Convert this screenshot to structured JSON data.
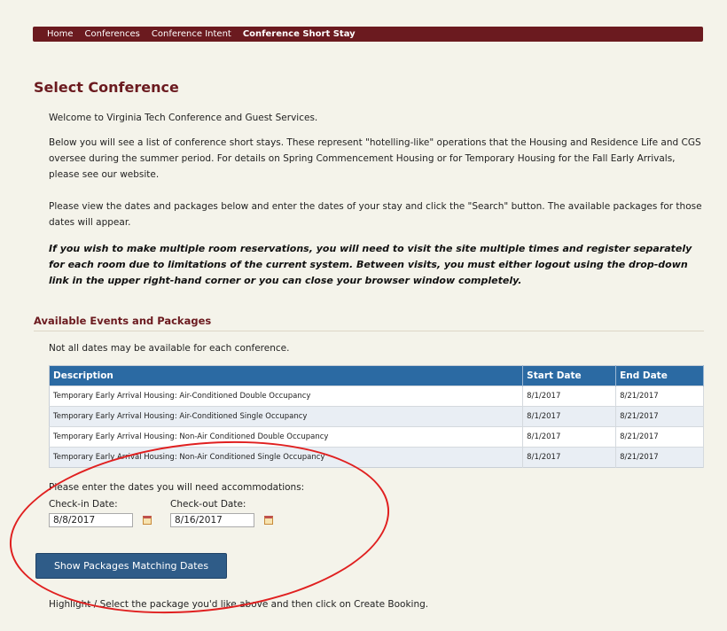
{
  "nav": {
    "items": [
      {
        "label": "Home"
      },
      {
        "label": "Conferences"
      },
      {
        "label": "Conference Intent"
      },
      {
        "label": "Conference Short Stay"
      }
    ]
  },
  "page": {
    "title": "Select Conference",
    "welcome": "Welcome to Virginia Tech Conference and Guest Services.",
    "intro": "Below you will see a list of conference short stays. These represent \"hotelling-like\" operations that the Housing and Residence Life and CGS oversee during the summer period.   For details on Spring Commencement Housing or for Temporary Housing for the Fall Early Arrivals, please see our website.",
    "instructions": "Please view the dates and packages below and enter the dates of your stay and click the \"Search\" button.  The available packages for those dates will appear.",
    "warning": "If you wish to make multiple room reservations, you will need to visit the site multiple times and register separately for each room due to limitations of the current system.  Between visits, you must either logout using the drop-down link in the upper right-hand corner or you can close your browser window completely."
  },
  "events": {
    "section_title": "Available Events and Packages",
    "note": "Not all dates may be available for each conference.",
    "columns": [
      "Description",
      "Start Date",
      "End Date"
    ],
    "rows": [
      {
        "description": "Temporary Early Arrival Housing: Air-Conditioned Double Occupancy",
        "start": "8/1/2017",
        "end": "8/21/2017"
      },
      {
        "description": "Temporary Early Arrival Housing: Air-Conditioned Single Occupancy",
        "start": "8/1/2017",
        "end": "8/21/2017"
      },
      {
        "description": "Temporary Early Arrival Housing: Non-Air Conditioned Double Occupancy",
        "start": "8/1/2017",
        "end": "8/21/2017"
      },
      {
        "description": "Temporary Early Arrival Housing: Non-Air Conditioned Single Occupancy",
        "start": "8/1/2017",
        "end": "8/21/2017"
      }
    ]
  },
  "dates": {
    "prompt": "Please enter the dates you will need accommodations:",
    "checkin_label": "Check-in Date:",
    "checkin_value": "8/8/2017",
    "checkout_label": "Check-out Date:",
    "checkout_value": "8/16/2017"
  },
  "actions": {
    "show_packages_label": "Show Packages Matching Dates"
  },
  "footer": {
    "text": "Highlight / Select the package you'd like above and then click on Create Booking."
  },
  "colors": {
    "brand_maroon": "#6b1a1f",
    "table_header": "#2b6aa3",
    "button": "#2f5c88",
    "annotation": "#e02020"
  }
}
